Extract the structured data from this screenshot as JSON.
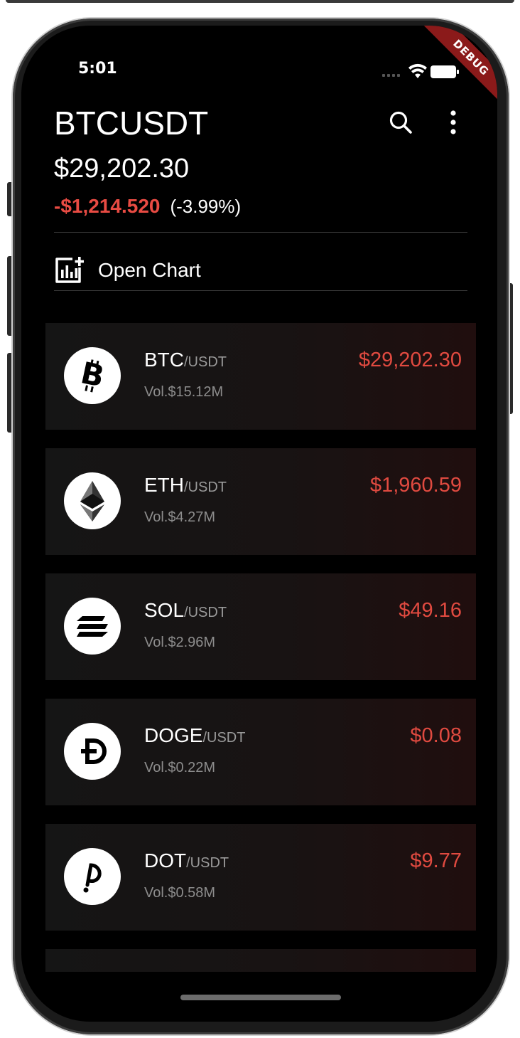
{
  "status_bar": {
    "time": "5:01",
    "debug_label": "DEBUG"
  },
  "header": {
    "symbol": "BTCUSDT",
    "price": "$29,202.30",
    "change_abs": "-$1,214.520",
    "change_pct": "(-3.99%)"
  },
  "actions": {
    "open_chart_label": "Open Chart"
  },
  "coins": [
    {
      "base": "BTC",
      "quote": "/USDT",
      "volume": "Vol.$15.12M",
      "price": "$29,202.30"
    },
    {
      "base": "ETH",
      "quote": "/USDT",
      "volume": "Vol.$4.27M",
      "price": "$1,960.59"
    },
    {
      "base": "SOL",
      "quote": "/USDT",
      "volume": "Vol.$2.96M",
      "price": "$49.16"
    },
    {
      "base": "DOGE",
      "quote": "/USDT",
      "volume": "Vol.$0.22M",
      "price": "$0.08"
    },
    {
      "base": "DOT",
      "quote": "/USDT",
      "volume": "Vol.$0.58M",
      "price": "$9.77"
    }
  ],
  "colors": {
    "negative": "#e04a40",
    "background": "#000000",
    "text": "#ffffff"
  }
}
